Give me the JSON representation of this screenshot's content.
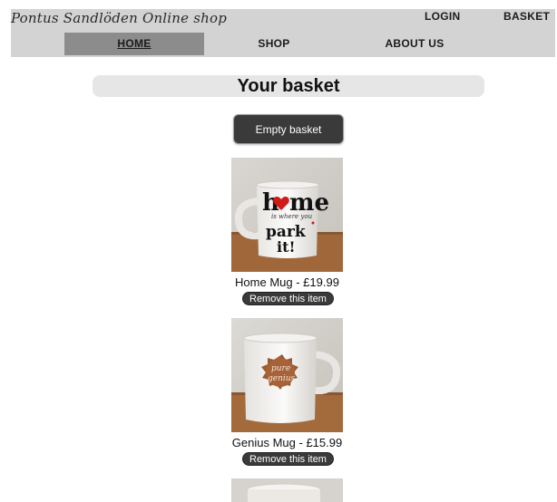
{
  "header": {
    "brand": "Pontus Sandlöden Online shop",
    "login_label": "LOGIN",
    "basket_label": "BASKET",
    "nav": [
      {
        "label": "HOME"
      },
      {
        "label": "SHOP"
      },
      {
        "label": "ABOUT US"
      }
    ]
  },
  "main": {
    "title": "Your basket",
    "empty_label": "Empty basket",
    "items": [
      {
        "caption": "Home Mug - £19.99",
        "remove_label": "Remove this item",
        "mug_text": [
          "home",
          "is where you",
          "park",
          "it!"
        ]
      },
      {
        "caption": "Genius Mug - £15.99",
        "remove_label": "Remove this item",
        "mug_text": [
          "pure",
          "genius"
        ]
      }
    ]
  },
  "colors": {
    "header_bg": "#d3d3d3",
    "active_nav_bg": "#8c8c8c",
    "button_bg": "#3a3a3a",
    "title_bg": "#e6e6e6"
  }
}
